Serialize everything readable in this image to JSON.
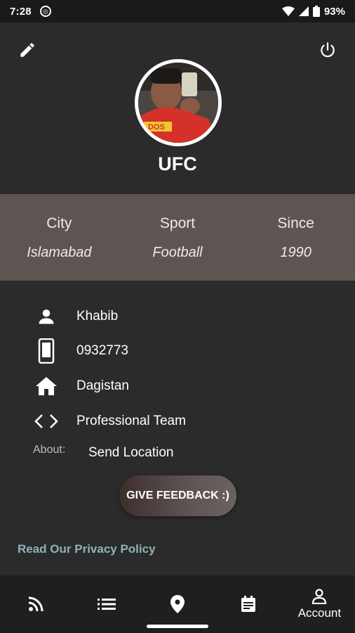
{
  "status_bar": {
    "time": "7:28",
    "battery": "93%"
  },
  "profile": {
    "name": "UFC"
  },
  "info": [
    {
      "label": "City",
      "value": "Islamabad"
    },
    {
      "label": "Sport",
      "value": "Football"
    },
    {
      "label": "Since",
      "value": "1990"
    }
  ],
  "details": {
    "name": "Khabib",
    "phone": "0932773",
    "address": "Dagistan",
    "team": "Professional Team",
    "about_label": "About:",
    "about_value": "Send Location"
  },
  "feedback_button": "GIVE FEEDBACK :)",
  "privacy_link": "Read Our Privacy Policy",
  "bottom_nav": {
    "account_label": "Account",
    "items": [
      "rss-icon",
      "list-icon",
      "location-icon",
      "calendar-icon",
      "account-icon"
    ]
  },
  "colors": {
    "background": "#2b2b2b",
    "info_band": "#5e5553",
    "link": "#8fb3b6",
    "nav": "#1f1f1f"
  }
}
